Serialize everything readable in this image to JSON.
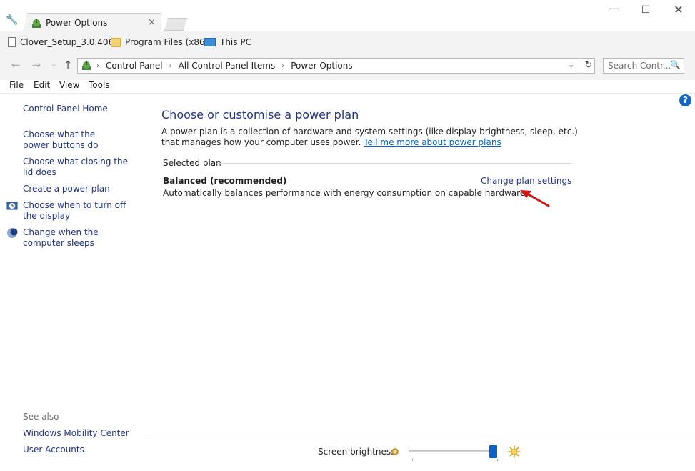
{
  "window": {
    "tab_title": "Power Options",
    "tab_close": "×",
    "min_glyph": "—",
    "max_glyph": "☐",
    "close_glyph": "✕"
  },
  "bookmarks": [
    {
      "label": "Clover_Setup_3.0.406",
      "icon": "file-icon"
    },
    {
      "label": "Program Files (x86)",
      "icon": "folder-icon"
    },
    {
      "label": "This PC",
      "icon": "computer-icon"
    }
  ],
  "nav": {
    "back": "←",
    "forward": "→",
    "recent": "⌄",
    "up": "↑"
  },
  "address": {
    "crumbs": [
      "Control Panel",
      "All Control Panel Items",
      "Power Options"
    ],
    "separator": "›",
    "dropdown": "⌄",
    "refresh": "↻"
  },
  "search": {
    "placeholder": "Search Contr...",
    "icon": "🔍"
  },
  "menu": [
    "File",
    "Edit",
    "View",
    "Tools"
  ],
  "help_glyph": "?",
  "sidebar": {
    "home": "Control Panel Home",
    "links": [
      "Choose what the power buttons do",
      "Choose what closing the lid does",
      "Create a power plan",
      "Choose when to turn off the display",
      "Change when the computer sleeps"
    ],
    "see_also_label": "See also",
    "see_also": [
      "Windows Mobility Center",
      "User Accounts"
    ]
  },
  "main": {
    "heading": "Choose or customise a power plan",
    "description": "A power plan is a collection of hardware and system settings (like display brightness, sleep, etc.) that manages how your computer uses power.",
    "learn_more": "Tell me more about power plans",
    "group_label": "Selected plan",
    "plan_name": "Balanced (recommended)",
    "plan_description": "Automatically balances performance with energy consumption on capable hardware.",
    "change_link": "Change plan settings"
  },
  "footer": {
    "brightness_label": "Screen brightness:",
    "brightness_value": 1.0
  },
  "colors": {
    "link": "#1e3287",
    "accent": "#0a64c8",
    "annotation_arrow": "#d11616"
  }
}
